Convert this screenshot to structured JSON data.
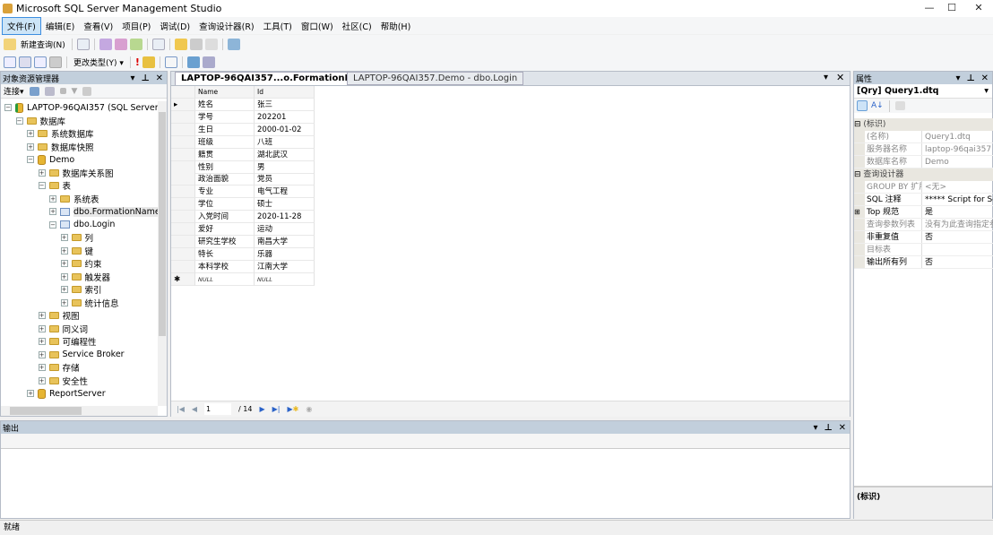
{
  "app": {
    "title": "Microsoft SQL Server Management Studio"
  },
  "menu": [
    "文件(F)",
    "编辑(E)",
    "查看(V)",
    "项目(P)",
    "调试(D)",
    "查询设计器(R)",
    "工具(T)",
    "窗口(W)",
    "社区(C)",
    "帮助(H)"
  ],
  "toolbar1": {
    "new_query": "新建查询(N)"
  },
  "toolbar2": {
    "change_type": "更改类型(Y)"
  },
  "object_explorer": {
    "title": "对象资源管理器",
    "connect": "连接",
    "tree": [
      {
        "label": "LAPTOP-96QAI357 (SQL Server 10",
        "level": 0,
        "icon": "server",
        "exp": "-"
      },
      {
        "label": "数据库",
        "level": 1,
        "icon": "folder",
        "exp": "-"
      },
      {
        "label": "系统数据库",
        "level": 2,
        "icon": "folder",
        "exp": "+"
      },
      {
        "label": "数据库快照",
        "level": 2,
        "icon": "folder",
        "exp": "+"
      },
      {
        "label": "Demo",
        "level": 2,
        "icon": "database",
        "exp": "-"
      },
      {
        "label": "数据库关系图",
        "level": 3,
        "icon": "folder",
        "exp": "+"
      },
      {
        "label": "表",
        "level": 3,
        "icon": "folder",
        "exp": "-"
      },
      {
        "label": "系统表",
        "level": 4,
        "icon": "folder",
        "exp": "+"
      },
      {
        "label": "dbo.FormationName",
        "level": 4,
        "icon": "table",
        "exp": "+",
        "selected": true
      },
      {
        "label": "dbo.Login",
        "level": 4,
        "icon": "table",
        "exp": "-"
      },
      {
        "label": "列",
        "level": 5,
        "icon": "folder",
        "exp": "+"
      },
      {
        "label": "键",
        "level": 5,
        "icon": "folder",
        "exp": "+"
      },
      {
        "label": "约束",
        "level": 5,
        "icon": "folder",
        "exp": "+"
      },
      {
        "label": "触发器",
        "level": 5,
        "icon": "folder",
        "exp": "+"
      },
      {
        "label": "索引",
        "level": 5,
        "icon": "folder",
        "exp": "+"
      },
      {
        "label": "统计信息",
        "level": 5,
        "icon": "folder",
        "exp": "+"
      },
      {
        "label": "视图",
        "level": 3,
        "icon": "folder",
        "exp": "+"
      },
      {
        "label": "同义词",
        "level": 3,
        "icon": "folder",
        "exp": "+"
      },
      {
        "label": "可编程性",
        "level": 3,
        "icon": "folder",
        "exp": "+"
      },
      {
        "label": "Service Broker",
        "level": 3,
        "icon": "folder",
        "exp": "+"
      },
      {
        "label": "存储",
        "level": 3,
        "icon": "folder",
        "exp": "+"
      },
      {
        "label": "安全性",
        "level": 3,
        "icon": "folder",
        "exp": "+"
      },
      {
        "label": "ReportServer",
        "level": 2,
        "icon": "database",
        "exp": "+"
      }
    ]
  },
  "tabs": [
    {
      "label": "LAPTOP-96QAI357...o.FormationName",
      "active": true
    },
    {
      "label": "LAPTOP-96QAI357.Demo - dbo.Login",
      "active": false
    }
  ],
  "grid": {
    "columns": [
      "Name",
      "Id"
    ],
    "rows": [
      [
        "姓名",
        "张三"
      ],
      [
        "学号",
        "202201"
      ],
      [
        "生日",
        "2000-01-02"
      ],
      [
        "班级",
        "八班"
      ],
      [
        "籍贯",
        "湖北武汉"
      ],
      [
        "性别",
        "男"
      ],
      [
        "政治面貌",
        "党员"
      ],
      [
        "专业",
        "电气工程"
      ],
      [
        "学位",
        "硕士"
      ],
      [
        "入党时间",
        "2020-11-28"
      ],
      [
        "爱好",
        "运动"
      ],
      [
        "研究生学校",
        "南昌大学"
      ],
      [
        "特长",
        "乐器"
      ],
      [
        "本科学校",
        "江南大学"
      ]
    ],
    "new_row": [
      "NULL",
      "NULL"
    ]
  },
  "navigator": {
    "current": "1",
    "total": "/ 14"
  },
  "properties": {
    "title": "属性",
    "object": "[Qry] Query1.dtq",
    "description": "(标识)",
    "rows": [
      {
        "type": "cat",
        "name": "(标识)"
      },
      {
        "name": "(名称)",
        "value": "Query1.dtq",
        "dim": true
      },
      {
        "name": "服务器名称",
        "value": "laptop-96qai357",
        "dim": true
      },
      {
        "name": "数据库名称",
        "value": "Demo",
        "dim": true
      },
      {
        "type": "cat",
        "name": "查询设计器"
      },
      {
        "name": "GROUP BY 扩展",
        "value": "<无>",
        "dim": true
      },
      {
        "name": "SQL 注释",
        "value": "***** Script for Se"
      },
      {
        "name": "Top 规范",
        "value": "是",
        "exp": true
      },
      {
        "name": "查询参数列表",
        "value": "没有为此查询指定参数",
        "dim": true
      },
      {
        "name": "非重复值",
        "value": "否"
      },
      {
        "name": "目标表",
        "value": "",
        "dim": true
      },
      {
        "name": "输出所有列",
        "value": "否"
      }
    ]
  },
  "output": {
    "title": "输出"
  },
  "status": {
    "text": "就绪"
  }
}
